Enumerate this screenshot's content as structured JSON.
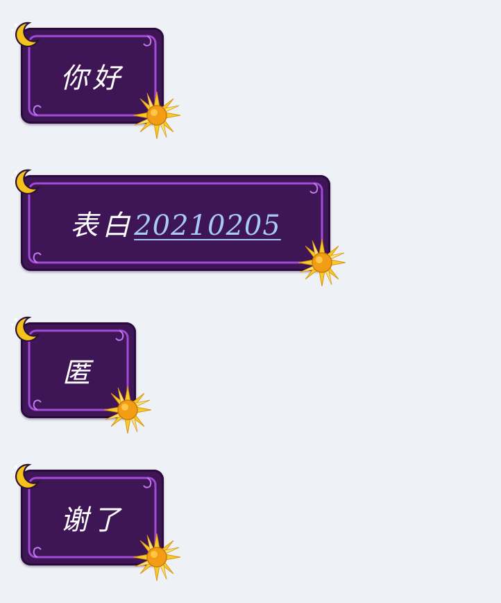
{
  "conversation": {
    "messages": [
      {
        "text": "你好"
      },
      {
        "text": "表白",
        "link": "20210205"
      },
      {
        "text": "匿"
      },
      {
        "text": "谢了"
      }
    ]
  },
  "theme": {
    "background": "#eef1f6",
    "bubble_fill": "#3e1555",
    "bubble_border": "#a34bd6",
    "text_color": "#ffffff",
    "link_color": "#a9c9f8",
    "moon_color": "#f5c21b",
    "sun_color": "#f6a21a"
  },
  "icons": {
    "moon": "crescent-moon-icon",
    "sun": "sun-icon"
  }
}
